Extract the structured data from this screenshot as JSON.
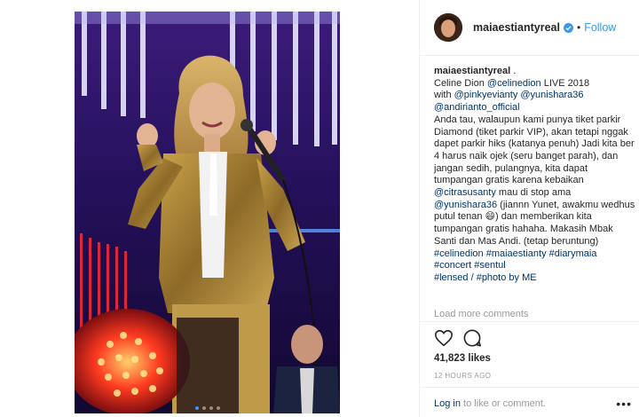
{
  "header": {
    "username": "maiaestiantyreal",
    "separator": "•",
    "follow_label": "Follow",
    "verified_icon": "verified-badge-icon"
  },
  "caption": {
    "username": "maiaestiantyreal",
    "after_username": " .",
    "line1_pre": "Celine Dion ",
    "line1_mention": "@celinedion",
    "line1_post": " LIVE 2018",
    "line2_pre": "with ",
    "line2_m1": "@pinkyevianty",
    "line2_m2": "@yunishara36",
    "line3_mention": "@andirianto_official",
    "body1": "Anda tau, walaupun kami punya tiket parkir Diamond (tiket parkir VIP), akan tetapi nggak dapet parkir hiks (katanya penuh) Jadi kita ber 4 harus naik ojek (seru banget parah), dan jangan sedih, pulangnya, kita dapat tumpangan gratis karena kebaikan",
    "body_mention1": "@citrasusanty",
    "body2": " mau di stop ama",
    "body_mention2": "@yunishara36",
    "body3": " (jiannn Yunet, awakmu wedhus putul tenan ",
    "emoji": "😄",
    "body4": ") dan memberikan kita tumpangan gratis hahaha. Makasih Mbak Santi dan Mas Andi. (tetap beruntung)",
    "hashtags_line1": "#celinedion #maiaestianty #diarymaia",
    "hashtags_line2": "#concert #sentul",
    "hashtags_line3": "#lensed / #photo by ME"
  },
  "load_more": "Load more comments",
  "likes": "41,823 likes",
  "time": "12 HOURS AGO",
  "login": {
    "link": "Log in",
    "rest": " to like or comment.",
    "more": "•••"
  },
  "colors": {
    "accent": "#3897f0",
    "link": "#003569",
    "muted": "#999999",
    "border": "#efefef"
  },
  "carousel": {
    "count": 4,
    "active": 1
  }
}
